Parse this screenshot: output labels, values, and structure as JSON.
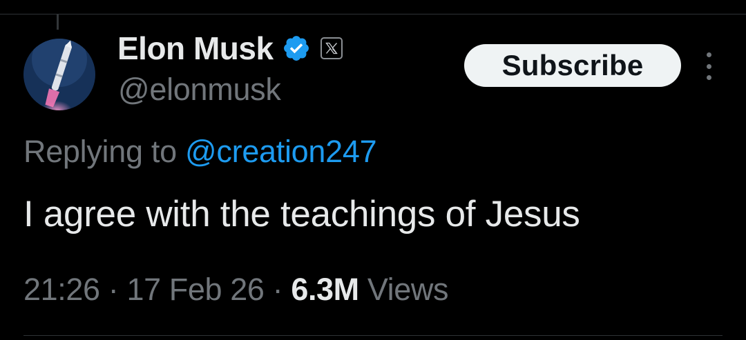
{
  "tweet": {
    "author": {
      "display_name": "Elon Musk",
      "handle": "@elonmusk",
      "verified": true,
      "affiliation_badge": "x-logo-icon"
    },
    "subscribe_label": "Subscribe",
    "more_icon": "more-vertical-icon",
    "reply_prefix": "Replying to",
    "reply_to": "@creation247",
    "text": "I agree with the teachings of Jesus",
    "time": "21:26",
    "date": "17 Feb 26",
    "separator": "·",
    "views_count": "6.3M",
    "views_label": "Views"
  },
  "colors": {
    "background": "#000000",
    "primary_text": "#e7e9ea",
    "secondary_text": "#71767b",
    "link": "#1d9bf0",
    "verified_badge": "#1d9bf0",
    "button_background": "#eff3f4",
    "button_text": "#0f1419"
  }
}
